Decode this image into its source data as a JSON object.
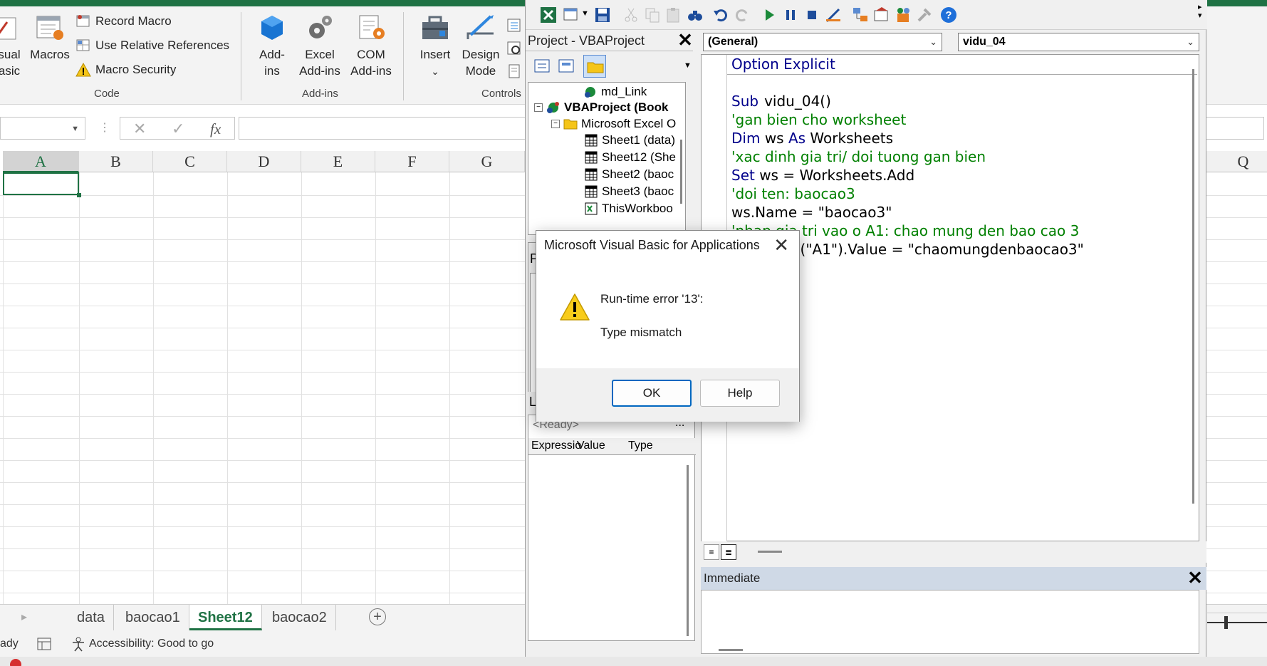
{
  "ribbon": {
    "visual_basic_line1": "sual",
    "visual_basic_line2": "asic",
    "macros": "Macros",
    "record_macro": "Record Macro",
    "use_relative": "Use Relative References",
    "macro_security": "Macro Security",
    "group_code": "Code",
    "addins_line1": "Add-",
    "addins_line2": "ins",
    "excel_addins_line1": "Excel",
    "excel_addins_line2": "Add-ins",
    "com_addins_line1": "COM",
    "com_addins_line2": "Add-ins",
    "group_addins": "Add-ins",
    "insert": "Insert",
    "design_mode_line1": "Design",
    "design_mode_line2": "Mode",
    "group_controls": "Controls",
    "accent_color": "#1f7244"
  },
  "formula_bar": {
    "cancel": "✕",
    "enter": "✓",
    "fx": "fx"
  },
  "grid": {
    "columns": [
      "A",
      "B",
      "C",
      "D",
      "E",
      "F",
      "G"
    ],
    "right_column": "Q"
  },
  "sheet_tabs": {
    "tabs": [
      "data",
      "baocao1",
      "Sheet12",
      "baocao2"
    ],
    "active": "Sheet12"
  },
  "status": {
    "ready": "ady",
    "accessibility": "Accessibility: Good to go"
  },
  "vbe": {
    "project_title": "Project - VBAProject",
    "tree": {
      "md_link": "md_Link",
      "vbaproject": "VBAProject (Book",
      "ms_excel_objects": "Microsoft Excel O",
      "sheet1": "Sheet1 (data)",
      "sheet12": "Sheet12 (She",
      "sheet2": "Sheet2 (baoc",
      "sheet3": "Sheet3 (baoc",
      "thisworkbook": "ThisWorkboo"
    },
    "properties_letter": "P",
    "locals_letter": "Lo",
    "locals_ready": "<Ready>",
    "locals_more": "...",
    "locals_cols": [
      "Expressio",
      "Value",
      "Type"
    ],
    "combo_general": "(General)",
    "combo_proc": "vidu_04",
    "code_lines": [
      {
        "kind": "kw",
        "text": "Option Explicit"
      },
      {
        "kind": "blank",
        "text": ""
      },
      {
        "kind": "sub",
        "text": "vidu_04()"
      },
      {
        "kind": "cm",
        "text": "'gan bien cho worksheet"
      },
      {
        "kind": "dim",
        "text": "Worksheets"
      },
      {
        "kind": "cm",
        "text": "'xac dinh gia tri/ doi tuong gan bien"
      },
      {
        "kind": "set",
        "text": "ws = Worksheets.Add"
      },
      {
        "kind": "cm",
        "text": "'doi ten: baocao3"
      },
      {
        "kind": "tx",
        "text": "ws.Name = \"baocao3\""
      },
      {
        "kind": "cm",
        "text": "'nhap gia tri vao o A1: chao mung den bao cao 3"
      },
      {
        "kind": "tx",
        "text": "ws.Range(\"A1\").Value = \"chaomungdenbaocao3\""
      }
    ],
    "kw_sub": "Sub",
    "kw_dim": "Dim",
    "kw_ws_as": "ws",
    "kw_as": "As",
    "kw_set": "Set",
    "immediate_title": "Immediate"
  },
  "dialog": {
    "title": "Microsoft Visual Basic for Applications",
    "close": "✕",
    "message1": "Run-time error '13':",
    "message2": "Type mismatch",
    "ok": "OK",
    "help": "Help"
  }
}
